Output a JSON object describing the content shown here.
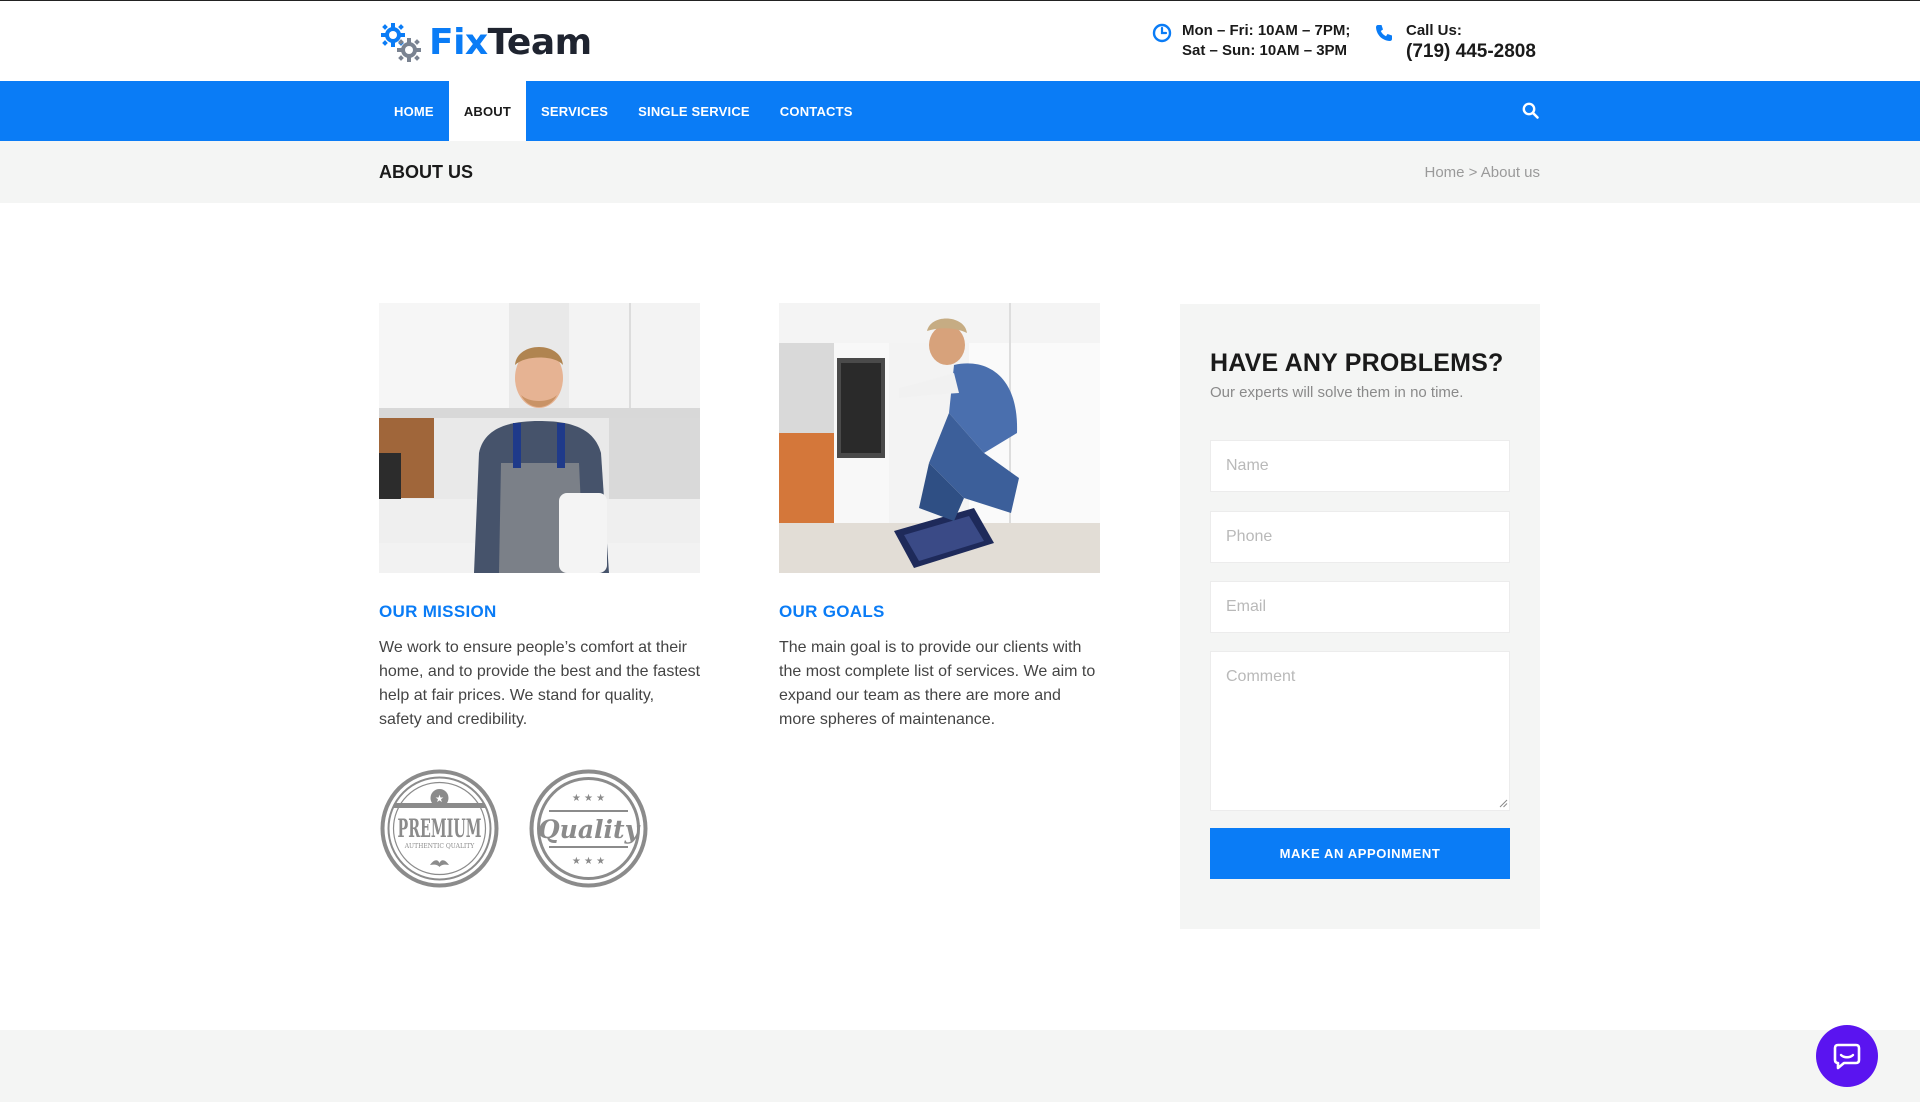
{
  "brand": {
    "part1": "Fix",
    "part2": "Team",
    "primary_color": "#0a7cf6",
    "dark_color": "#1f2430"
  },
  "header": {
    "hours_line1": "Mon – Fri: 10AM – 7PM;",
    "hours_line2": "Sat – Sun: 10AM – 3PM",
    "call_label": "Call Us:",
    "phone": "(719) 445-2808",
    "hours_icon": "clock-icon",
    "call_icon": "phone-icon"
  },
  "nav": {
    "items": [
      {
        "label": "HOME",
        "active": false
      },
      {
        "label": "ABOUT",
        "active": true
      },
      {
        "label": "SERVICES",
        "active": false
      },
      {
        "label": "SINGLE SERVICE",
        "active": false
      },
      {
        "label": "CONTACTS",
        "active": false
      }
    ],
    "search_icon": "search-icon"
  },
  "page": {
    "title": "ABOUT US",
    "breadcrumb": {
      "home": "Home",
      "separator": ">",
      "current": "About us"
    }
  },
  "mission": {
    "title": "OUR MISSION",
    "text": "We work to ensure people’s comfort at their home, and to provide the best and the fastest help at fair prices. We stand for quality, safety and credibility."
  },
  "goals": {
    "title": "OUR GOALS",
    "text": "The main goal is to provide our clients with the most complete list of services. We aim to expand our team as there are more and more spheres of maintenance."
  },
  "badges": [
    {
      "name": "premium-badge",
      "text": "PREMIUM",
      "subtext": "AUTHENTIC QUALITY"
    },
    {
      "name": "quality-badge",
      "text": "Quality"
    }
  ],
  "form": {
    "title": "HAVE ANY PROBLEMS?",
    "subtitle": "Our experts will solve them in no time.",
    "name_placeholder": "Name",
    "phone_placeholder": "Phone",
    "email_placeholder": "Email",
    "comment_placeholder": "Comment",
    "submit_label": "MAKE AN APPOINMENT"
  },
  "chat": {
    "icon": "chat-bubble-icon",
    "color": "#5a14f0"
  }
}
